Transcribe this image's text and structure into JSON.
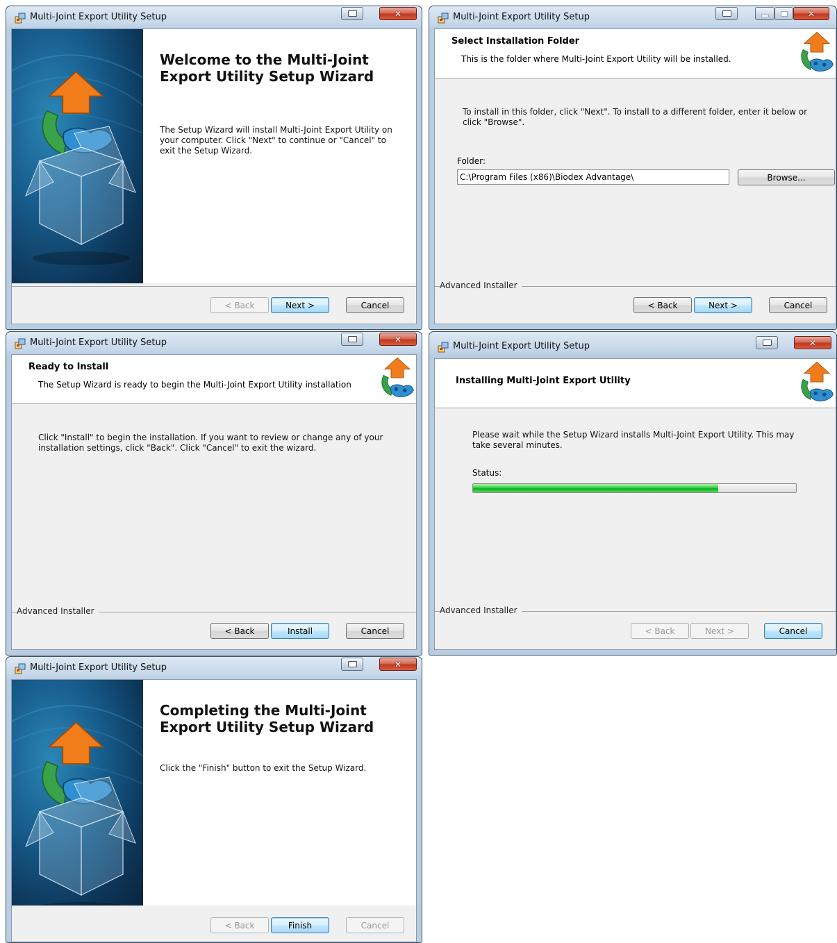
{
  "window_title": "Multi-Joint Export Utility Setup",
  "buttons": {
    "back": "< Back",
    "next": "Next >",
    "cancel": "Cancel",
    "install": "Install",
    "finish": "Finish",
    "browse": "Browse..."
  },
  "footer_brand": "Advanced Installer",
  "welcome": {
    "heading": "Welcome to the Multi-Joint Export Utility Setup Wizard",
    "body": "The Setup Wizard will install Multi-Joint Export Utility on your computer.  Click \"Next\" to continue or \"Cancel\" to exit the Setup Wizard."
  },
  "select_folder": {
    "title": "Select Installation Folder",
    "subtitle": "This is the folder where Multi-Joint Export Utility will be installed.",
    "instructions": "To install in this folder, click \"Next\". To install to a different folder, enter it below or click \"Browse\".",
    "folder_label": "Folder:",
    "folder_value": "C:\\Program Files (x86)\\Biodex Advantage\\"
  },
  "ready": {
    "title": "Ready to Install",
    "subtitle": "The Setup Wizard is ready to begin the Multi-Joint Export Utility installation",
    "body": "Click \"Install\" to begin the installation.  If you want to review or change any of your installation settings, click \"Back\".  Click \"Cancel\" to exit the wizard."
  },
  "installing": {
    "title": "Installing Multi-Joint Export Utility",
    "body": "Please wait while the Setup Wizard installs Multi-Joint Export Utility.  This may take several minutes.",
    "status_label": "Status:",
    "progress_fraction": 0.76
  },
  "completing": {
    "heading": "Completing the Multi-Joint Export Utility Setup Wizard",
    "body": "Click the \"Finish\" button to exit the Setup Wizard."
  },
  "colors": {
    "progress": "#06b025",
    "default_button_border": "#3c7fb1",
    "close_button": "#c2381f"
  }
}
